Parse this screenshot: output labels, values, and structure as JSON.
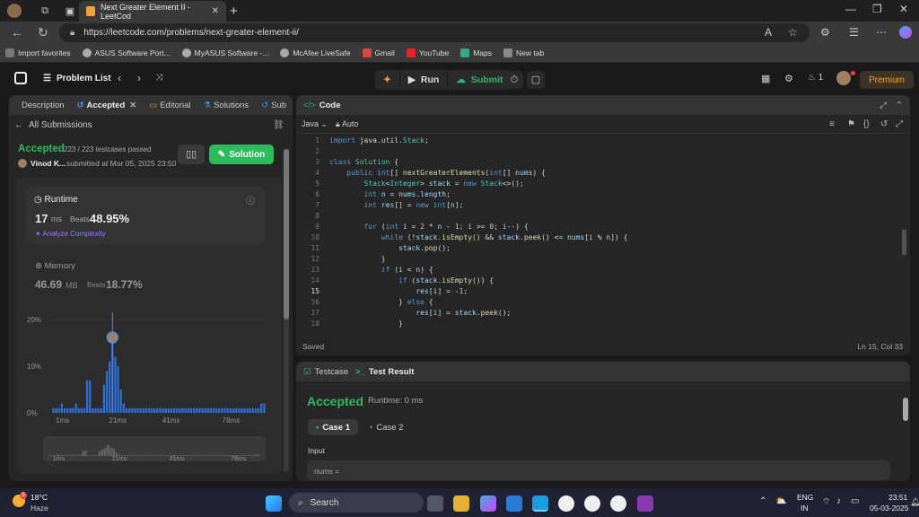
{
  "browser": {
    "tab_title": "Next Greater Element II - LeetCod",
    "url": "https://leetcode.com/problems/next-greater-element-ii/",
    "bookmarks": [
      "Import favorites",
      "ASUS Software Port...",
      "MyASUS Software -...",
      "McAfee LiveSafe",
      "Gmail",
      "YouTube",
      "Maps",
      "New tab"
    ]
  },
  "topbar": {
    "problem_list": "Problem List",
    "run": "Run",
    "submit": "Submit",
    "streak": "1",
    "premium": "Premium"
  },
  "left": {
    "tabs": [
      "Description",
      "Accepted",
      "Editorial",
      "Solutions",
      "Sub"
    ],
    "all_submissions": "All Submissions",
    "status": "Accepted",
    "testcases": "223 / 223 testcases passed",
    "user": "Vinod K...",
    "submitted": "submitted at Mar 05, 2025 23:50",
    "solution_btn": "Solution",
    "runtime_label": "Runtime",
    "runtime_value": "17",
    "runtime_unit": "ms",
    "beats": "Beats",
    "runtime_beats": "48.95%",
    "analyze": "Analyze Complexity",
    "memory_label": "Memory",
    "memory_value": "46.69",
    "memory_unit": "MB",
    "memory_beats": "18.77%"
  },
  "chart_data": {
    "type": "bar",
    "y_ticks": [
      "20%",
      "10%",
      "0%"
    ],
    "x_ticks": [
      "1ms",
      "21ms",
      "41ms",
      "78ms"
    ],
    "ylim": [
      0,
      20
    ],
    "values": [
      1,
      1,
      1,
      2,
      1,
      1,
      1,
      1,
      2,
      1,
      1,
      1,
      7,
      7,
      1,
      1,
      1,
      1,
      6,
      9,
      11,
      15,
      12,
      10,
      5,
      2,
      1,
      1,
      1,
      1,
      1,
      1,
      1,
      1,
      1,
      1,
      1,
      1,
      1,
      1,
      1,
      1,
      1,
      1,
      1,
      1,
      1,
      1,
      1,
      1,
      1,
      1,
      1,
      1,
      1,
      1,
      1,
      1,
      1,
      1,
      1,
      1,
      1,
      1,
      1,
      1,
      1,
      1,
      1,
      1,
      1,
      1,
      1,
      1,
      2,
      2
    ],
    "highlight_index": 21
  },
  "mini_chart": {
    "x_ticks": [
      "1ms",
      "21ms",
      "41ms",
      "78ms"
    ]
  },
  "editor": {
    "title": "Code",
    "language": "Java",
    "mode": "Auto",
    "saved": "Saved",
    "cursor": "Ln 15, Col 33"
  },
  "code_lines": [
    "import java.util.Stack;",
    "",
    "class Solution {",
    "    public int[] nextGreaterElements(int[] nums) {",
    "        Stack<Integer> stack = new Stack<>();",
    "        int n = nums.length;",
    "        int res[] = new int[n];",
    "",
    "        for (int i = 2 * n - 1; i >= 0; i--) {",
    "            while (!stack.isEmpty() && stack.peek() <= nums[i % n]) {",
    "                stack.pop();",
    "            }",
    "            if (i < n) {",
    "                if (stack.isEmpty()) {",
    "                    res[i] = -1;",
    "                } else {",
    "                    res[i] = stack.peek();",
    "                }"
  ],
  "result": {
    "testcase_tab": "Testcase",
    "result_tab": "Test Result",
    "status": "Accepted",
    "runtime": "Runtime: 0 ms",
    "case1": "Case 1",
    "case2": "Case 2",
    "input_label": "Input",
    "input_value": "nums ="
  },
  "taskbar": {
    "weather_temp": "18°C",
    "weather_desc": "Haze",
    "search": "Search",
    "lang": "ENG",
    "region": "IN",
    "time": "23:51",
    "date": "05-03-2025"
  }
}
